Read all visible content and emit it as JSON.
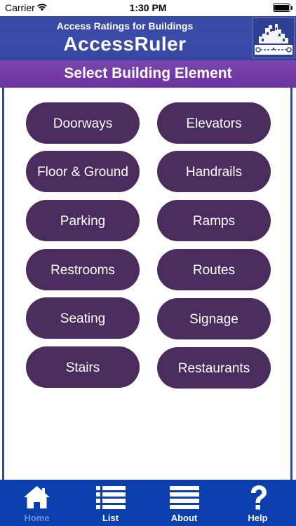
{
  "status_bar": {
    "carrier": "Carrier",
    "time": "1:30 PM"
  },
  "header": {
    "subtitle": "Access Ratings for Buildings",
    "title": "AccessRuler"
  },
  "section": {
    "title": "Select Building Element"
  },
  "elements": [
    "Doorways",
    "Elevators",
    "Floor & Ground",
    "Handrails",
    "Parking",
    "Ramps",
    "Restrooms",
    "Routes",
    "Seating",
    "Signage",
    "Stairs",
    "Restaurants"
  ],
  "tabs": [
    {
      "label": "Home",
      "icon": "home-icon",
      "active": true
    },
    {
      "label": "List",
      "icon": "list-icon",
      "active": false
    },
    {
      "label": "About",
      "icon": "menu-icon",
      "active": false
    },
    {
      "label": "Help",
      "icon": "help-icon",
      "active": false
    }
  ],
  "colors": {
    "header_blue": "#3a4ca8",
    "section_purple": "#6a34a0",
    "button_purple": "#4b2c5f",
    "tab_bar_blue": "#0b3fae",
    "active_tab": "#6f8fd6"
  }
}
